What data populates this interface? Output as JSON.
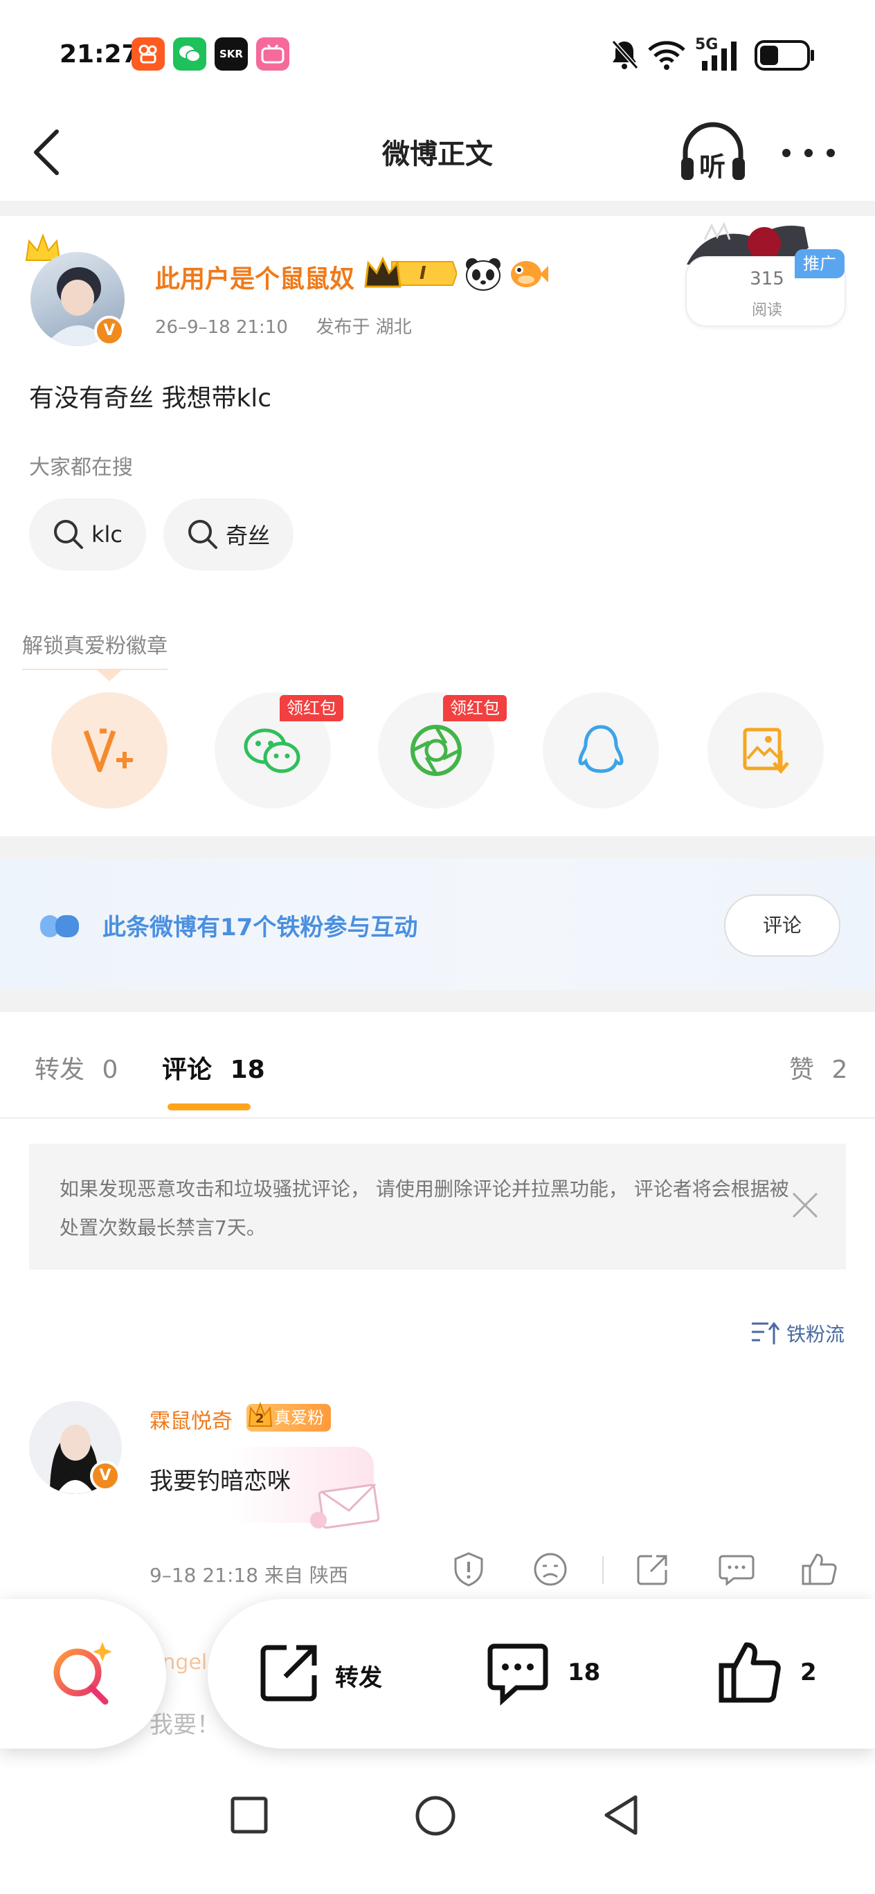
{
  "status_bar": {
    "time": "21:27",
    "network": "5G",
    "app_icons": [
      "kuaishou-icon",
      "wechat-icon",
      "skr-icon",
      "bilibili-icon"
    ]
  },
  "header": {
    "title": "微博正文",
    "listen_label": "听"
  },
  "post": {
    "username": "此用户是个鼠鼠奴",
    "level_badge": "I",
    "date": "26–9–18  21:10",
    "published_at": "发布于  湖北",
    "read_count": "315",
    "read_label": "阅读",
    "promo_label": "推广",
    "text": "有没有奇丝  我想带klc",
    "search_heading": "大家都在搜",
    "search_chips": [
      "klc",
      "奇丝"
    ]
  },
  "share": {
    "unlock_label": "解锁真爱粉徽章",
    "red_packet_label": "领红包",
    "targets": [
      "vplus",
      "wechat",
      "moments",
      "qq",
      "save-image"
    ]
  },
  "fans_banner": {
    "text": "此条微博有17个铁粉参与互动",
    "button": "评论"
  },
  "tabs": {
    "repost_label": "转发",
    "repost_count": "0",
    "comment_label": "评论",
    "comment_count": "18",
    "like_label": "赞",
    "like_count": "2"
  },
  "notice": {
    "text": "如果发现恶意攻击和垃圾骚扰评论， 请使用删除评论并拉黑功能， 评论者将会根据被处置次数最长禁言7天。"
  },
  "comments": {
    "sort_label": "铁粉流",
    "first": {
      "username": "霖鼠悦奇",
      "badge": "真爱粉",
      "badge_level": "2",
      "text": "我要钓暗恋咪",
      "meta": "9–18  21:18  来自  陕西"
    },
    "second_partial": {
      "username": "angel",
      "text": "我要！"
    }
  },
  "bottom_bar": {
    "repost_label": "转发",
    "comment_count": "18",
    "like_count": "2"
  },
  "colors": {
    "accent_orange": "#ef7a1a",
    "tab_underline": "#ffa41b",
    "fans_blue": "#4a8fe0",
    "red_badge": "#f23f3f"
  }
}
